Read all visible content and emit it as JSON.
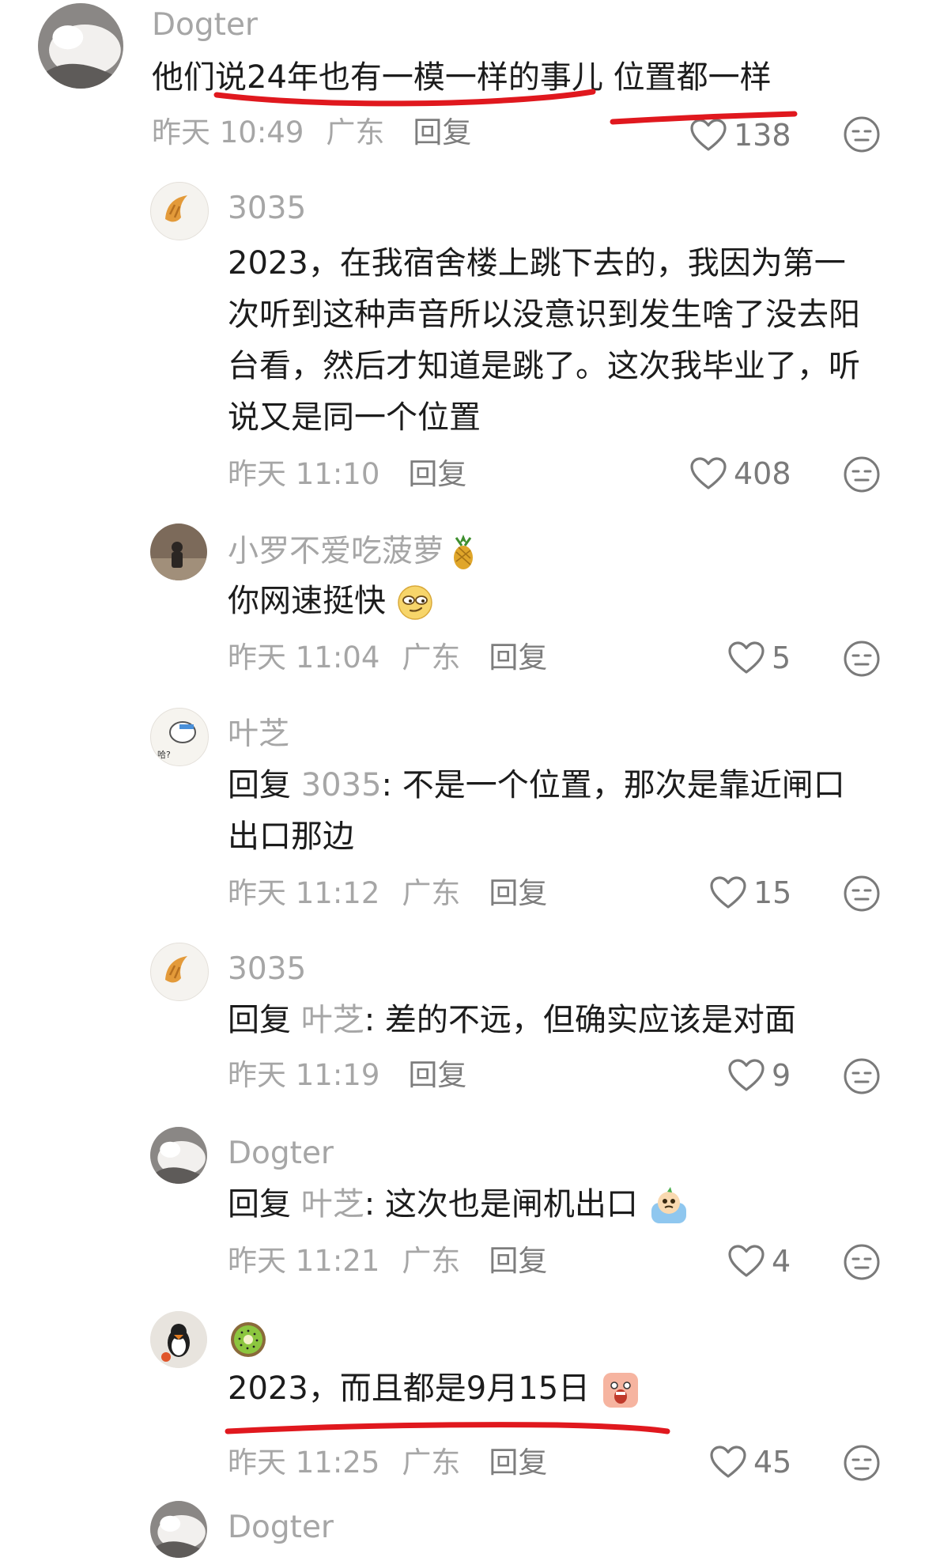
{
  "comments": [
    {
      "author": "Dogter",
      "lines": [
        "他们说24年也有一模一样的事儿 位置都一样"
      ],
      "time": "昨天 10:49",
      "location": "广东",
      "reply_label": "回复",
      "likes": "138"
    },
    {
      "author": "3035",
      "lines": [
        "2023，在我宿舍楼上跳下去的，我因为第一",
        "次听到这种声音所以没意识到发生啥了没去阳",
        "台看，然后才知道是跳了。这次我毕业了，听",
        "说又是同一个位置"
      ],
      "time": "昨天 11:10",
      "reply_label": "回复",
      "likes": "408"
    },
    {
      "author": "小罗不爱吃菠萝",
      "author_emoji": "pineapple-emoji",
      "text": "你网速挺快",
      "text_emoji": "smirk-emoji",
      "time": "昨天 11:04",
      "location": "广东",
      "reply_label": "回复",
      "likes": "5"
    },
    {
      "author": "叶芝",
      "reply_prefix": "回复",
      "reply_to": "3035",
      "lines": [
        "不是一个位置，那次是靠近闸口",
        "出口那边"
      ],
      "time": "昨天 11:12",
      "location": "广东",
      "reply_label": "回复",
      "likes": "15"
    },
    {
      "author": "3035",
      "reply_prefix": "回复",
      "reply_to": "叶芝",
      "text": "差的不远，但确实应该是对面",
      "time": "昨天 11:19",
      "reply_label": "回复",
      "likes": "9"
    },
    {
      "author": "Dogter",
      "reply_prefix": "回复",
      "reply_to": "叶芝",
      "text": "这次也是闸机出口",
      "text_emoji": "crying-emoji",
      "time": "昨天 11:21",
      "location": "广东",
      "reply_label": "回复",
      "likes": "4"
    },
    {
      "author_emoji": "kiwi-emoji",
      "text": "2023，而且都是9月15日",
      "text_emoji": "scream-emoji",
      "time": "昨天 11:25",
      "location": "广东",
      "reply_label": "回复",
      "likes": "45"
    },
    {
      "author": "Dogter"
    }
  ],
  "colors": {
    "muted": "#a6a6a6",
    "text": "#1c1c1c",
    "annotation_red": "#e0181e"
  },
  "icons": {
    "like": "heart-outline-icon",
    "react": "neutral-face-icon"
  }
}
